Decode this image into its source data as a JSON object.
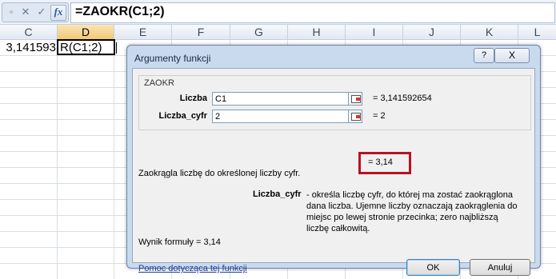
{
  "formula_bar": {
    "cancel_icon": "x-icon",
    "enter_icon": "check-icon",
    "fx_label": "fx",
    "formula": "=ZAOKR(C1;2)"
  },
  "columns": [
    "C",
    "D",
    "E",
    "F",
    "G",
    "H",
    "I",
    "J",
    "K",
    "L"
  ],
  "cells": {
    "c1": "3,141593",
    "d1": "R(C1;2)"
  },
  "dialog": {
    "title": "Argumenty funkcji",
    "help_label": "?",
    "close_label": "X",
    "function_name": "ZAOKR",
    "args": [
      {
        "label": "Liczba",
        "value": "C1",
        "result": "=  3,141592654"
      },
      {
        "label": "Liczba_cyfr",
        "value": "2",
        "result": "=  2"
      }
    ],
    "function_result": "=  3,14",
    "description": "Zaokrągla liczbę do określonej liczby cyfr.",
    "param_name": "Liczba_cyfr",
    "param_description": "- określa liczbę cyfr, do której ma zostać zaokrąglona dana liczba. Ujemne liczby oznaczają zaokrąglenia do miejsc po lewej stronie przecinka; zero najbliższą liczbę całkowitą.",
    "formula_result": "Wynik formuły =   3,14",
    "help_link": "Pomoc dotycząca tej funkcji",
    "ok_label": "OK",
    "cancel_label": "Anuluj"
  },
  "colors": {
    "highlight_box": "#b81220",
    "active_column": "#f4c777",
    "dialog_frame": "#c9d9ee"
  }
}
